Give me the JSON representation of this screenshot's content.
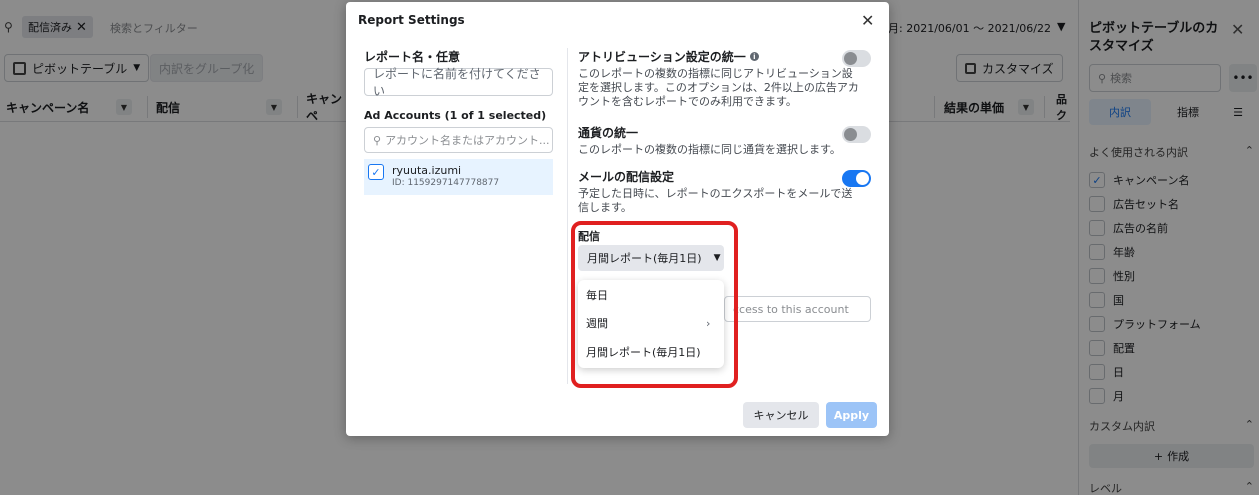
{
  "filter_bar": {
    "chip_label": "配信済み",
    "placeholder": "検索とフィルター",
    "date_range": "月: 2021/06/01 ～ 2021/06/22"
  },
  "toolbar": {
    "pivot_label": "ピボットテーブル",
    "group_label": "内訳をグループ化",
    "customize_label": "カスタマイズ"
  },
  "table": {
    "columns": [
      "キャンペーン名",
      "配信",
      "キャンペ",
      "結果の単価",
      "品ク"
    ]
  },
  "right_panel": {
    "title": "ピボットテーブルのカスタマイズ",
    "search_placeholder": "検索",
    "more_label": "•••",
    "tabs": [
      "内訳",
      "指標"
    ],
    "section_common": "よく使用される内訳",
    "items": [
      {
        "label": "キャンペーン名",
        "checked": true
      },
      {
        "label": "広告セット名",
        "checked": false
      },
      {
        "label": "広告の名前",
        "checked": false
      },
      {
        "label": "年齢",
        "checked": false
      },
      {
        "label": "性別",
        "checked": false
      },
      {
        "label": "国",
        "checked": false
      },
      {
        "label": "プラットフォーム",
        "checked": false
      },
      {
        "label": "配置",
        "checked": false
      },
      {
        "label": "日",
        "checked": false
      },
      {
        "label": "月",
        "checked": false
      }
    ],
    "section_custom": "カスタム内訳",
    "create_label": "作成",
    "section_level": "レベル"
  },
  "modal": {
    "title": "Report Settings",
    "report_name_label": "レポート名・任意",
    "report_name_placeholder": "レポートに名前を付けてください",
    "accounts_label": "Ad Accounts (1 of 1 selected)",
    "accounts_search_placeholder": "アカウント名またはアカウント...",
    "account": {
      "name": "ryuuta.izumi",
      "id": "ID: 1159297147778877",
      "checked": true
    },
    "attribution": {
      "title": "アトリビューション設定の統一",
      "desc": "このレポートの複数の指標に同じアトリビューション設定を選択します。このオプションは、2件以上の広告アカウントを含むレポートでのみ利用できます。",
      "on": false
    },
    "currency": {
      "title": "通貨の統一",
      "desc": "このレポートの複数の指標に同じ通貨を選択します。",
      "on": false
    },
    "email": {
      "title": "メールの配信設定",
      "desc": "予定した日時に、レポートのエクスポートをメールで送信します。",
      "on": true
    },
    "delivery_label": "配信",
    "delivery_selected": "月間レポート(毎月1日)",
    "email_input_placeholder": "ccess to this account",
    "dropdown_options": [
      "毎日",
      "週間",
      "月間レポート(毎月1日)"
    ],
    "cancel_label": "キャンセル",
    "apply_label": "Apply"
  },
  "colors": {
    "accent": "#1877f2",
    "highlight": "#e02020"
  }
}
